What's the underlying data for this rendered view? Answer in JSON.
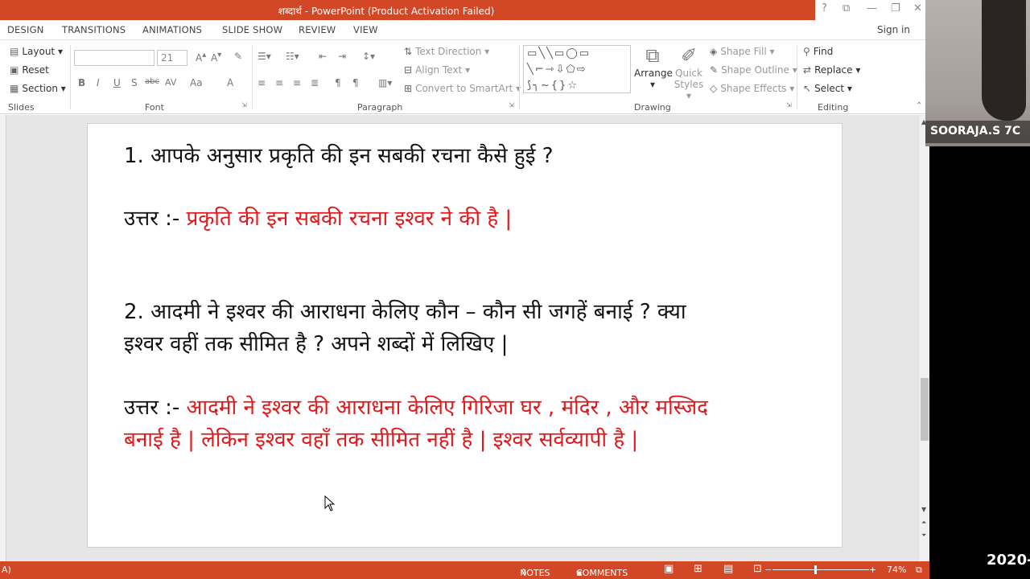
{
  "window": {
    "title": "शब्दार्थ -  PowerPoint (Product Activation Failed)",
    "controls": [
      "?",
      "⧉",
      "—",
      "❐",
      "✕"
    ]
  },
  "tabs": [
    "DESIGN",
    "TRANSITIONS",
    "ANIMATIONS",
    "SLIDE SHOW",
    "REVIEW",
    "VIEW"
  ],
  "signin": "Sign in",
  "ribbon": {
    "slides": {
      "layout": "Layout",
      "reset": "Reset",
      "section": "Section",
      "label": "Slides"
    },
    "font": {
      "size": "21",
      "label": "Font",
      "bold": "B",
      "italic": "I",
      "underline": "U",
      "strike": "S",
      "shadow": "abc",
      "spacing": "AV",
      "case": "Aa",
      "color": "A"
    },
    "paragraph": {
      "text_direction": "Text Direction",
      "align_text": "Align Text",
      "convert": "Convert to SmartArt",
      "label": "Paragraph"
    },
    "drawing": {
      "arrange": "Arrange",
      "quick_styles_1": "Quick",
      "quick_styles_2": "Styles",
      "shape_fill": "Shape Fill",
      "shape_outline": "Shape Outline",
      "shape_effects": "Shape Effects",
      "label": "Drawing"
    },
    "editing": {
      "find": "Find",
      "replace": "Replace",
      "select": "Select",
      "label": "Editing"
    }
  },
  "slide": {
    "q1": "1.   आपके अनुसार प्रकृति की इन सबकी रचना कैसे हुई ?",
    "a1_prefix": "उत्तर :- ",
    "a1": "प्रकृति की इन सबकी रचना इश्वर ने की है |",
    "q2_line1": "2. आदमी ने इश्वर की आराधना केलिए कौन – कौन सी जगहें बनाई ? क्या",
    "q2_line2": "इश्वर वहीं तक सीमित है ? अपने शब्दों में लिखिए |",
    "a2_prefix": "उत्तर :- ",
    "a2_line1": "आदमी ने इश्वर की आराधना केलिए गिरिजा घर , मंदिर , और मस्जिद",
    "a2_line2": "बनाई है | लेकिन इश्वर वहाँ तक सीमित नहीं है | इश्वर सर्वव्यापी है |"
  },
  "status": {
    "left": "A)",
    "notes": "NOTES",
    "comments": "COMMENTS",
    "zoom": "74%"
  },
  "video": {
    "name": "SOORAJA.S  7C"
  },
  "clock": "2020-",
  "colors": {
    "accent": "#d24726",
    "answer": "#e0191d"
  }
}
